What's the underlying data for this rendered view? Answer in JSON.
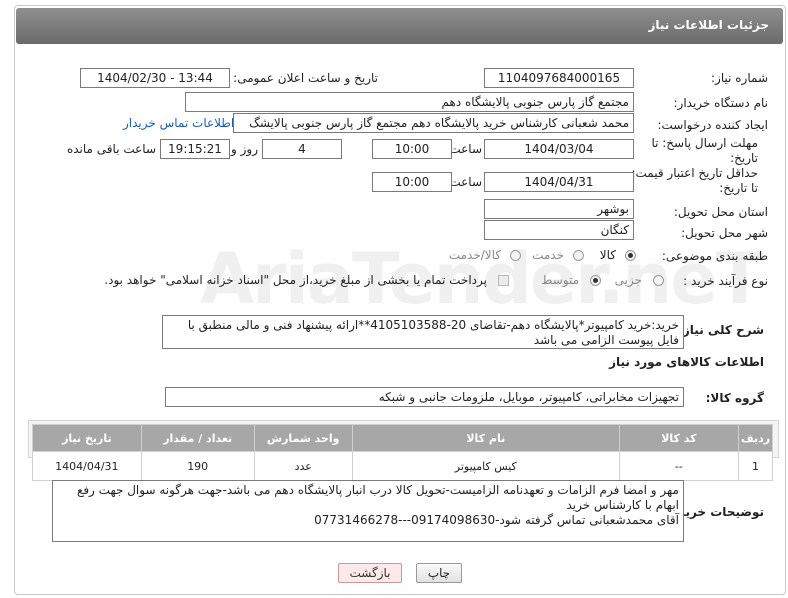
{
  "header": {
    "title": "جزئیات اطلاعات نیاز"
  },
  "fields": {
    "need_number_label": "شماره نیاز:",
    "need_number": "1104097684000165",
    "announce_label": "تاریخ و ساعت اعلان عمومی:",
    "announce_value": "1404/02/30 - 13:44",
    "buyer_org_label": "نام دستگاه خریدار:",
    "buyer_org": "مجتمع گاز پارس جنوبی  پالایشگاه دهم",
    "creator_label": "ایجاد کننده درخواست:",
    "creator": "محمد شعبانی کارشناس خرید پالایشگاه دهم  مجتمع گاز پارس جنوبی  پالایشگ",
    "buyer_contact_link": "اطلاعات تماس خریدار",
    "reply_deadline_label": "مهلت ارسال پاسخ: تا تاریخ:",
    "reply_date": "1404/03/04",
    "time_label": "ساعت",
    "reply_time": "10:00",
    "days_value": "4",
    "days_label": "روز و",
    "remaining_time": "19:15:21",
    "remaining_label": "ساعت باقی مانده",
    "price_validity_label": "حداقل تاریخ اعتبار قیمت: تا تاریخ:",
    "price_date": "1404/04/31",
    "price_time": "10:00",
    "province_label": "استان محل تحویل:",
    "province": "بوشهر",
    "city_label": "شهر محل تحویل:",
    "city": "کنگان",
    "category_label": "طبقه بندی موضوعی:",
    "category_options": [
      "کالا",
      "خدمت",
      "کالا/خدمت"
    ],
    "process_label": "نوع فرآیند خرید :",
    "process_options": [
      "جزیی",
      "متوسط"
    ],
    "payment_note": "پرداخت تمام یا بخشی از مبلغ خرید،از محل \"اسناد خزانه اسلامی\" خواهد بود."
  },
  "description": {
    "label": "شرح کلی نیاز:",
    "text": "خرید:خرید کامپیوتر*پالایشگاه دهم-تقاضای 20-4105103588**ارائه پیشنهاد فنی و مالی منطبق با فایل پیوست الزامی می باشد"
  },
  "goods_info_title": "اطلاعات کالاهای مورد نیاز",
  "goods_group": {
    "label": "گروه کالا:",
    "value": "تجهیزات مخابراتی، کامپیوتر، موبایل، ملزومات جانبی و شبکه"
  },
  "table": {
    "headers": [
      "ردیف",
      "کد کالا",
      "نام کالا",
      "واحد شمارش",
      "تعداد / مقدار",
      "تاریخ نیاز"
    ],
    "rows": [
      [
        "1",
        "--",
        "کیس کامپیوتر",
        "عدد",
        "190",
        "1404/04/31"
      ]
    ]
  },
  "buyer_notes": {
    "label": "توضیحات خریدار:",
    "lines": [
      "مهر و امضا فرم الزامات و تعهدنامه الزامیست-تحویل کالا درب انبار پالایشگاه دهم می باشد-جهت هرگونه سوال جهت رفع",
      "ابهام با کارشناس خرید",
      "آقای محمدشعبانی تماس گرفته شود-09174098630---07731466278"
    ]
  },
  "buttons": {
    "print": "چاپ",
    "back": "بازگشت"
  },
  "watermark": "AriaTender.neT"
}
